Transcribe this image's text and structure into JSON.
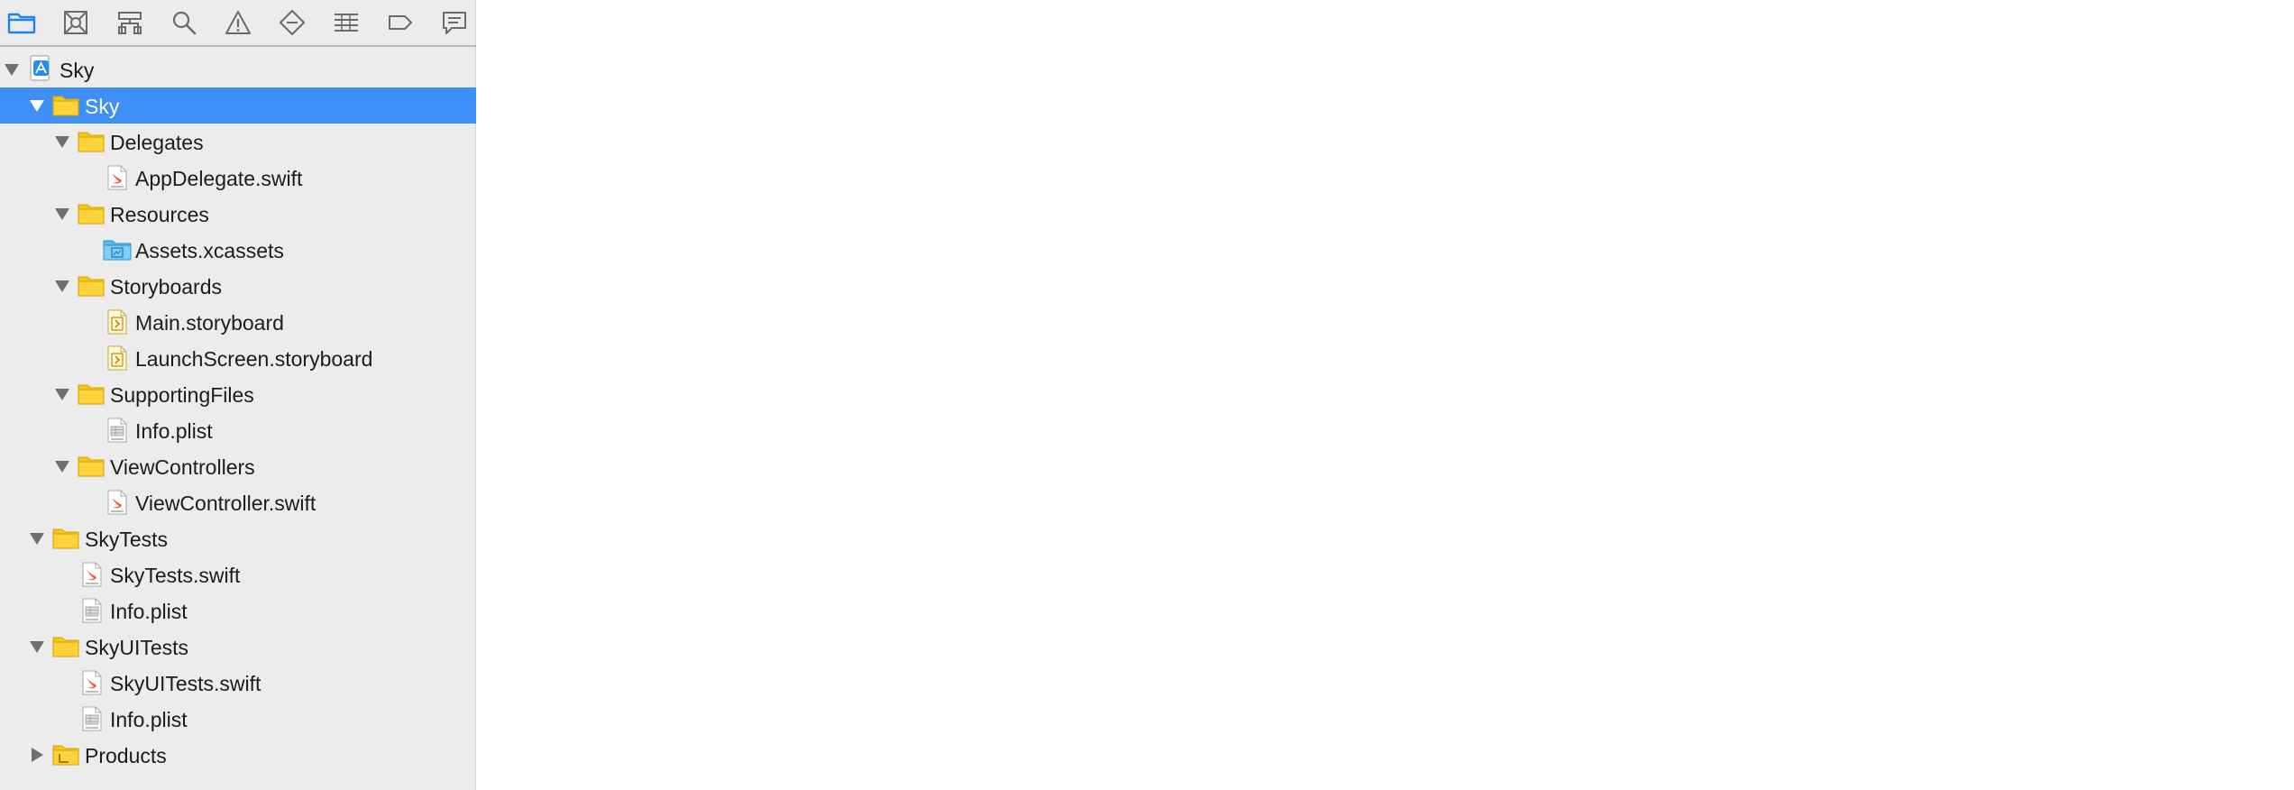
{
  "toolbar": {
    "items": [
      {
        "name": "project-navigator",
        "icon": "folder-icon",
        "active": true
      },
      {
        "name": "source-control-navigator",
        "icon": "source-control-icon"
      },
      {
        "name": "symbol-navigator",
        "icon": "hierarchy-icon"
      },
      {
        "name": "find-navigator",
        "icon": "search-icon"
      },
      {
        "name": "issue-navigator",
        "icon": "warning-icon"
      },
      {
        "name": "test-navigator",
        "icon": "diamond-icon"
      },
      {
        "name": "debug-navigator",
        "icon": "list-icon"
      },
      {
        "name": "breakpoint-navigator",
        "icon": "breakpoint-icon"
      },
      {
        "name": "report-navigator",
        "icon": "speech-bubble-icon"
      }
    ],
    "active_color": "#1a82fb",
    "icon_color": "#6b6b6b"
  },
  "tree": {
    "selected_color": "#3e8ff7",
    "rows": [
      {
        "label": "Sky",
        "level": 0,
        "type": "project",
        "expanded": true
      },
      {
        "label": "Sky",
        "level": 1,
        "type": "folder",
        "expanded": true,
        "selected": true
      },
      {
        "label": "Delegates",
        "level": 2,
        "type": "folder",
        "expanded": true
      },
      {
        "label": "AppDelegate.swift",
        "level": 3,
        "type": "swift"
      },
      {
        "label": "Resources",
        "level": 2,
        "type": "folder",
        "expanded": true
      },
      {
        "label": "Assets.xcassets",
        "level": 3,
        "type": "assets"
      },
      {
        "label": "Storyboards",
        "level": 2,
        "type": "folder",
        "expanded": true
      },
      {
        "label": "Main.storyboard",
        "level": 3,
        "type": "storyboard"
      },
      {
        "label": "LaunchScreen.storyboard",
        "level": 3,
        "type": "storyboard"
      },
      {
        "label": "SupportingFiles",
        "level": 2,
        "type": "folder",
        "expanded": true
      },
      {
        "label": "Info.plist",
        "level": 3,
        "type": "plist"
      },
      {
        "label": "ViewControllers",
        "level": 2,
        "type": "folder",
        "expanded": true
      },
      {
        "label": "ViewController.swift",
        "level": 3,
        "type": "swift"
      },
      {
        "label": "SkyTests",
        "level": 1,
        "type": "folder",
        "expanded": true
      },
      {
        "label": "SkyTests.swift",
        "level": 2,
        "type": "swift"
      },
      {
        "label": "Info.plist",
        "level": 2,
        "type": "plist"
      },
      {
        "label": "SkyUITests",
        "level": 1,
        "type": "folder",
        "expanded": true
      },
      {
        "label": "SkyUITests.swift",
        "level": 2,
        "type": "swift"
      },
      {
        "label": "Info.plist",
        "level": 2,
        "type": "plist"
      },
      {
        "label": "Products",
        "level": 1,
        "type": "products",
        "expanded": false
      }
    ]
  }
}
